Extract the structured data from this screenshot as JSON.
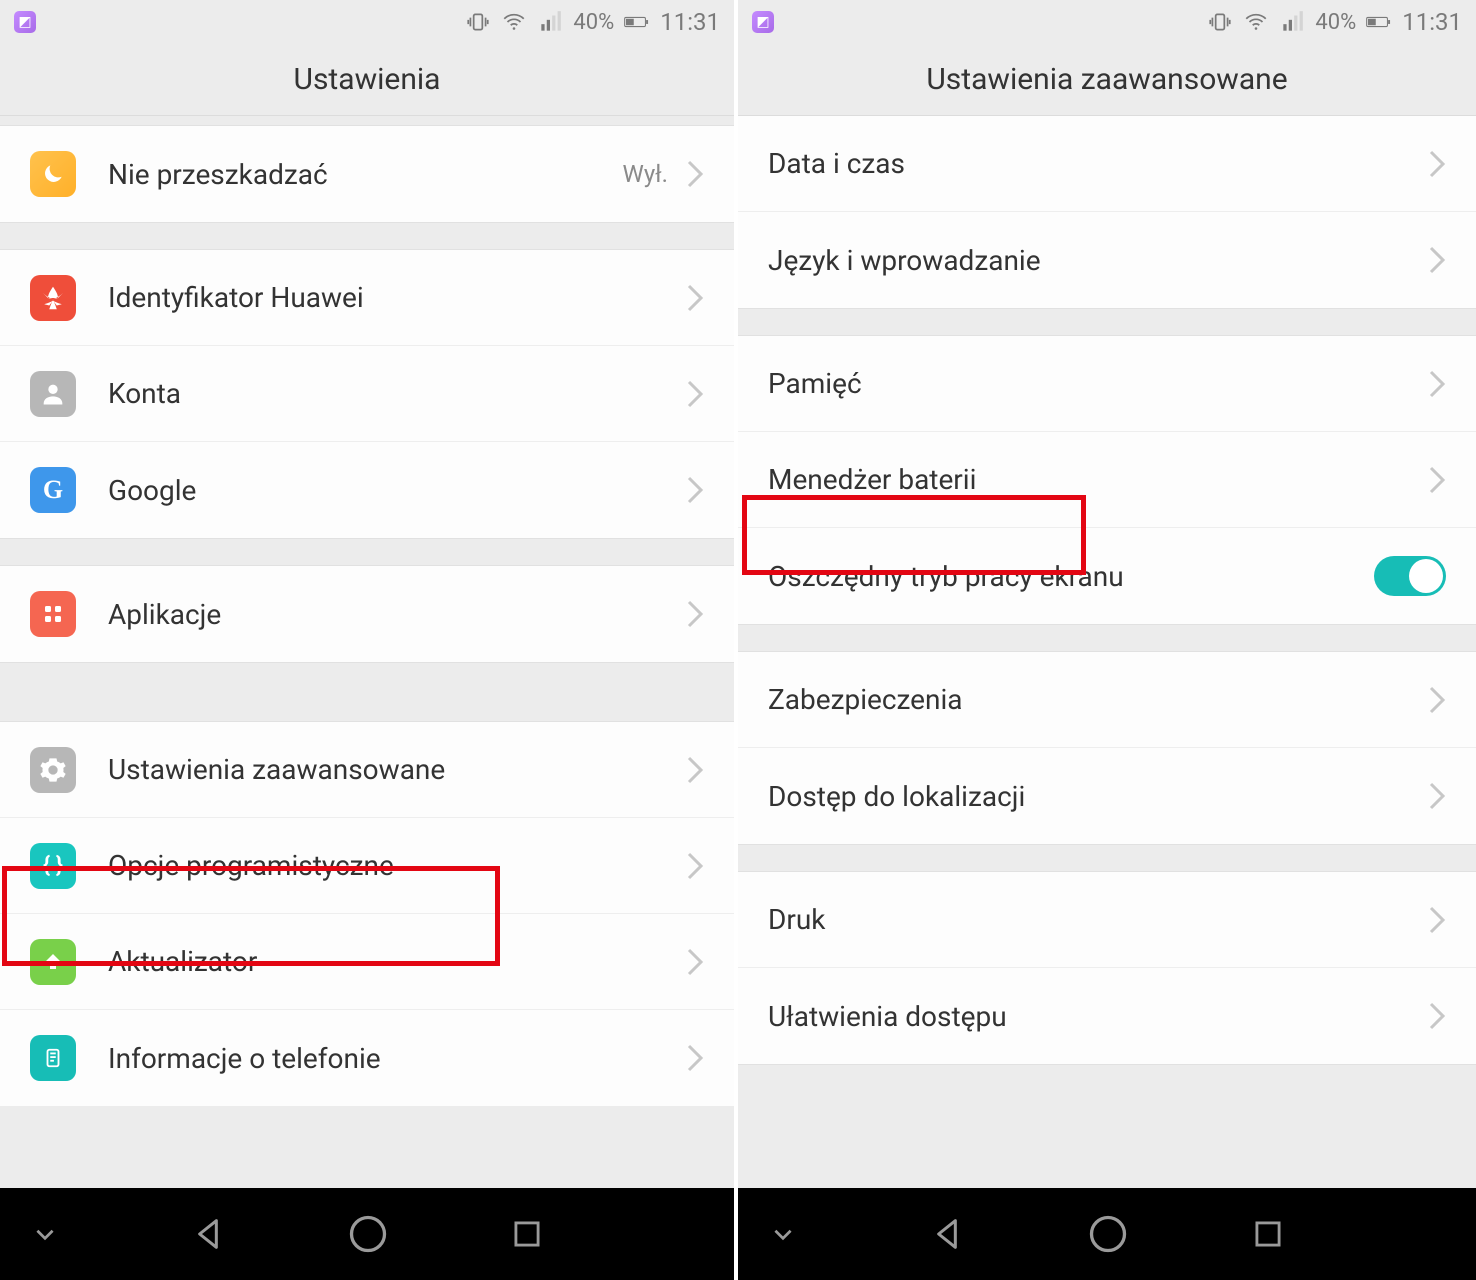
{
  "statusbar": {
    "battery_text": "40%",
    "time": "11:31"
  },
  "left": {
    "title": "Ustawienia",
    "rows": {
      "dnd": {
        "label": "Nie przeszkadzać",
        "value": "Wył."
      },
      "huawei_id": {
        "label": "Identyfikator Huawei"
      },
      "accounts": {
        "label": "Konta"
      },
      "google": {
        "label": "Google"
      },
      "apps": {
        "label": "Aplikacje"
      },
      "adv": {
        "label": "Ustawienia zaawansowane"
      },
      "dev": {
        "label": "Opcje programistyczne"
      },
      "updater": {
        "label": "Aktualizator"
      },
      "about": {
        "label": "Informacje o telefonie"
      }
    }
  },
  "right": {
    "title": "Ustawienia zaawansowane",
    "rows": {
      "date": {
        "label": "Data i czas"
      },
      "lang": {
        "label": "Język i wprowadzanie"
      },
      "memory": {
        "label": "Pamięć"
      },
      "battery": {
        "label": "Menedżer baterii"
      },
      "powersave": {
        "label": "Oszczędny tryb pracy ekranu"
      },
      "security": {
        "label": "Zabezpieczenia"
      },
      "location": {
        "label": "Dostęp do lokalizacji"
      },
      "print": {
        "label": "Druk"
      },
      "accessibility": {
        "label": "Ułatwienia dostępu"
      }
    }
  }
}
